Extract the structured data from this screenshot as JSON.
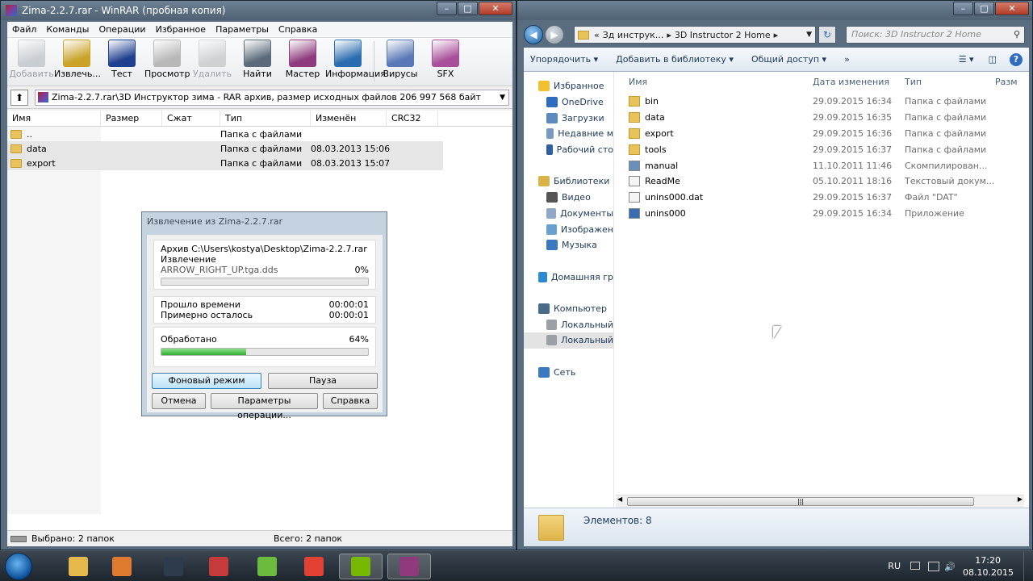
{
  "winrar": {
    "title": "Zima-2.2.7.rar - WinRAR (пробная копия)",
    "menu": [
      "Файл",
      "Команды",
      "Операции",
      "Избранное",
      "Параметры",
      "Справка"
    ],
    "toolbar": [
      {
        "label": "Добавить",
        "icon": "add-archive-icon",
        "enabled": false,
        "color": "#9aa2aa"
      },
      {
        "label": "Извлечь...",
        "icon": "extract-icon",
        "enabled": true,
        "color": "#c9a227"
      },
      {
        "label": "Тест",
        "icon": "test-icon",
        "enabled": true,
        "color": "#1f3f8f"
      },
      {
        "label": "Просмотр",
        "icon": "view-icon",
        "enabled": true,
        "color": "#b8b8b8"
      },
      {
        "label": "Удалить",
        "icon": "delete-icon",
        "enabled": false,
        "color": "#a9a9a9"
      },
      {
        "label": "Найти",
        "icon": "find-icon",
        "enabled": true,
        "color": "#5a6a7a"
      },
      {
        "label": "Мастер",
        "icon": "wizard-icon",
        "enabled": true,
        "color": "#8e3a7d"
      },
      {
        "label": "Информация",
        "icon": "info-icon",
        "enabled": true,
        "color": "#2b6cb0"
      },
      {
        "label": "Вирусы",
        "icon": "virus-scan-icon",
        "enabled": true,
        "color": "#5a78b8"
      },
      {
        "label": "SFX",
        "icon": "sfx-icon",
        "enabled": true,
        "color": "#a94e9a"
      }
    ],
    "path": "Zima-2.2.7.rar\\3D Инструктор зима - RAR архив, размер исходных файлов 206 997 568 байт",
    "columns": [
      "Имя",
      "Размер",
      "Сжат",
      "Тип",
      "Изменён",
      "CRC32"
    ],
    "rows": [
      {
        "name": "..",
        "type": "Папка с файлами",
        "modified": "",
        "selected": false
      },
      {
        "name": "data",
        "type": "Папка с файлами",
        "modified": "08.03.2013 15:06",
        "selected": true
      },
      {
        "name": "export",
        "type": "Папка с файлами",
        "modified": "08.03.2013 15:07",
        "selected": true
      }
    ],
    "status_left": "Выбрано: 2 папок",
    "status_right": "Всего: 2 папок"
  },
  "extract_dialog": {
    "title": "Извлечение из Zima-2.2.7.rar",
    "archive_line": "Архив C:\\Users\\kostya\\Desktop\\Zima-2.2.7.rar",
    "action": "Извлечение",
    "current_file": "ARROW_RIGHT_UP.tga.dds",
    "file_percent": "0%",
    "file_progress": 0,
    "elapsed_label": "Прошло времени",
    "elapsed": "00:00:01",
    "remaining_label": "Примерно осталось",
    "remaining": "00:00:01",
    "processed_label": "Обработано",
    "processed_percent": "64%",
    "processed_progress": 0.41,
    "buttons": {
      "background": "Фоновый режим",
      "pause": "Пауза",
      "cancel": "Отмена",
      "options": "Параметры операции...",
      "help": "Справка"
    }
  },
  "explorer": {
    "breadcrumb": [
      "«",
      "Зд инструк...",
      "3D Instructor 2 Home"
    ],
    "search_placeholder": "Поиск: 3D Instructor 2 Home",
    "commands": [
      "Упорядочить ▾",
      "Добавить в библиотеку ▾",
      "Общий доступ ▾",
      "»"
    ],
    "nav": [
      {
        "label": "Избранное",
        "icon": "star-icon",
        "indent": 0,
        "gap_before": false,
        "selected": false
      },
      {
        "label": "OneDrive",
        "icon": "onedrive-icon",
        "indent": 1,
        "gap_before": false,
        "selected": false
      },
      {
        "label": "Загрузки",
        "icon": "downloads-icon",
        "indent": 1,
        "gap_before": false,
        "selected": false
      },
      {
        "label": "Недавние м",
        "icon": "recent-places-icon",
        "indent": 1,
        "gap_before": false,
        "selected": false
      },
      {
        "label": "Рабочий сто",
        "icon": "desktop-icon",
        "indent": 1,
        "gap_before": false,
        "selected": false
      },
      {
        "label": "Библиотеки",
        "icon": "libraries-icon",
        "indent": 0,
        "gap_before": true,
        "selected": false
      },
      {
        "label": "Видео",
        "icon": "video-icon",
        "indent": 1,
        "gap_before": false,
        "selected": false
      },
      {
        "label": "Документы",
        "icon": "documents-icon",
        "indent": 1,
        "gap_before": false,
        "selected": false
      },
      {
        "label": "Изображен",
        "icon": "pictures-icon",
        "indent": 1,
        "gap_before": false,
        "selected": false
      },
      {
        "label": "Музыка",
        "icon": "music-icon",
        "indent": 1,
        "gap_before": false,
        "selected": false
      },
      {
        "label": "Домашняя гр",
        "icon": "homegroup-icon",
        "indent": 0,
        "gap_before": true,
        "selected": false
      },
      {
        "label": "Компьютер",
        "icon": "computer-icon",
        "indent": 0,
        "gap_before": true,
        "selected": false
      },
      {
        "label": "Локальный",
        "icon": "drive-icon",
        "indent": 1,
        "gap_before": false,
        "selected": false
      },
      {
        "label": "Локальный",
        "icon": "drive-icon",
        "indent": 1,
        "gap_before": false,
        "selected": true
      },
      {
        "label": "Сеть",
        "icon": "network-icon",
        "indent": 0,
        "gap_before": true,
        "selected": false
      }
    ],
    "columns": [
      "Имя",
      "Дата изменения",
      "Тип",
      "Разм"
    ],
    "files": [
      {
        "name": "bin",
        "date": "29.09.2015 16:34",
        "type": "Папка с файлами",
        "icon": "folder-icon",
        "color": "#e8c25a"
      },
      {
        "name": "data",
        "date": "29.09.2015 16:35",
        "type": "Папка с файлами",
        "icon": "folder-icon",
        "color": "#e8c25a"
      },
      {
        "name": "export",
        "date": "29.09.2015 16:36",
        "type": "Папка с файлами",
        "icon": "folder-icon",
        "color": "#e8c25a"
      },
      {
        "name": "tools",
        "date": "29.09.2015 16:37",
        "type": "Папка с файлами",
        "icon": "folder-icon",
        "color": "#e8c25a"
      },
      {
        "name": "manual",
        "date": "11.10.2011 11:46",
        "type": "Скомпилирован...",
        "icon": "chm-icon",
        "color": "#6a8fb8"
      },
      {
        "name": "ReadMe",
        "date": "05.10.2011 18:16",
        "type": "Текстовый докум...",
        "icon": "text-file-icon",
        "color": "#f4f4f4"
      },
      {
        "name": "unins000.dat",
        "date": "29.09.2015 16:37",
        "type": "Файл \"DAT\"",
        "icon": "dat-file-icon",
        "color": "#f4f4f4"
      },
      {
        "name": "unins000",
        "date": "29.09.2015 16:34",
        "type": "Приложение",
        "icon": "installer-icon",
        "color": "#3a6db0"
      }
    ],
    "item_count": "Элементов: 8"
  },
  "taskbar": {
    "apps": [
      {
        "name": "explorer",
        "icon": "explorer-icon",
        "color": "#e5b94c",
        "active": false
      },
      {
        "name": "media-player",
        "icon": "media-player-icon",
        "color": "#e07a2e",
        "active": false
      },
      {
        "name": "steam",
        "icon": "steam-icon",
        "color": "#2d3b4d",
        "active": false
      },
      {
        "name": "rubiks",
        "icon": "cube-app-icon",
        "color": "#c63a3a",
        "active": false
      },
      {
        "name": "utorrent",
        "icon": "utorrent-icon",
        "color": "#6dbb3e",
        "active": false
      },
      {
        "name": "chrome",
        "icon": "chrome-icon",
        "color": "#e34133",
        "active": false
      },
      {
        "name": "nvidia",
        "icon": "nvidia-icon",
        "color": "#76b900",
        "active": true
      },
      {
        "name": "winrar",
        "icon": "winrar-icon",
        "color": "#8e3a7d",
        "active": true
      }
    ],
    "language": "RU",
    "time": "17:20",
    "date": "08.10.2015"
  }
}
